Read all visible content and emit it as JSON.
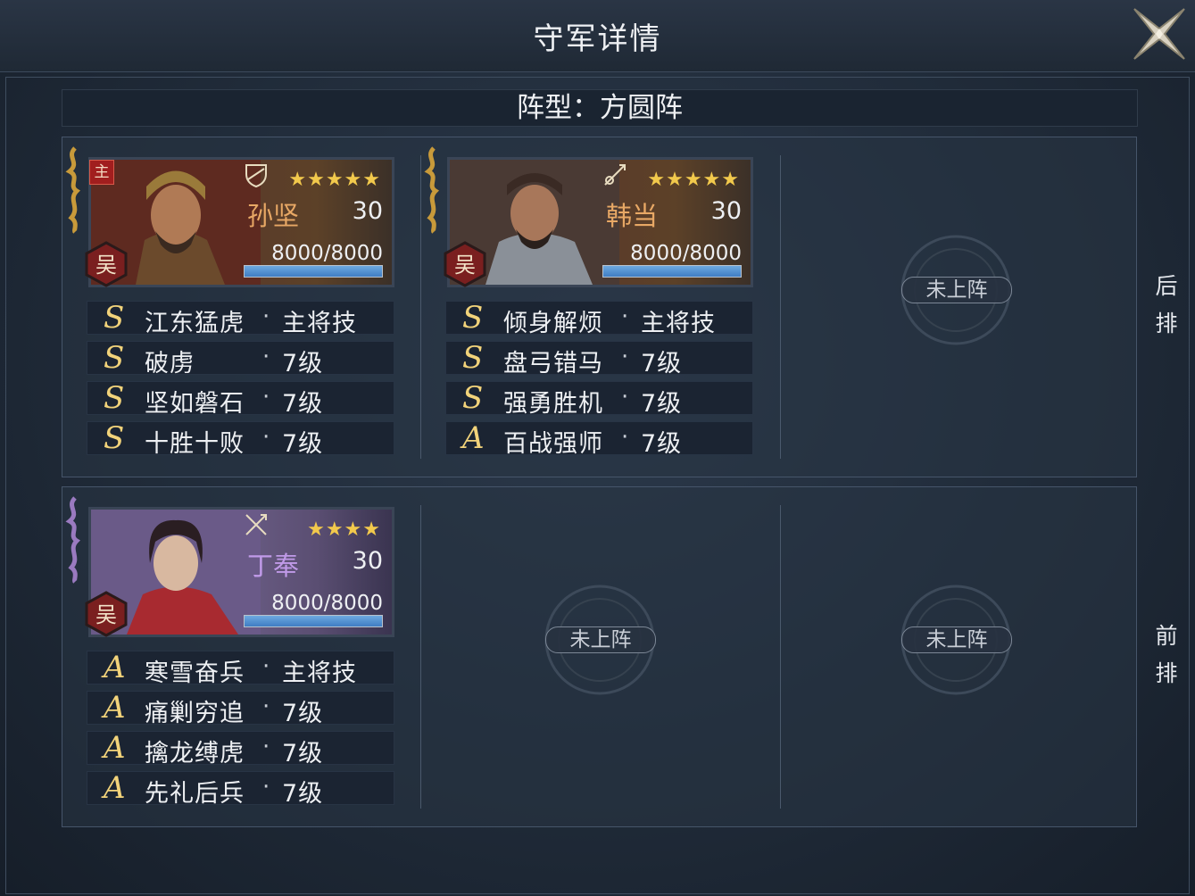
{
  "header": {
    "title": "守军详情"
  },
  "formation": {
    "label": "阵型：方圆阵"
  },
  "rows": {
    "back_label_1": "后",
    "back_label_2": "排",
    "front_label_1": "前",
    "front_label_2": "排"
  },
  "empty_slot_label": "未上阵",
  "heroes": [
    {
      "name": "孙坚",
      "level": "30",
      "troops": "8000/8000",
      "stars": "★★★★★",
      "main_badge": "主",
      "faction": "吴",
      "hp_fraction": 1.0,
      "skills": [
        {
          "grade": "S",
          "name": "江东猛虎",
          "level": "主将技"
        },
        {
          "grade": "S",
          "name": "破虏",
          "level": "7级"
        },
        {
          "grade": "S",
          "name": "坚如磐石",
          "level": "7级"
        },
        {
          "grade": "S",
          "name": "十胜十败",
          "level": "7级"
        }
      ]
    },
    {
      "name": "韩当",
      "level": "30",
      "troops": "8000/8000",
      "stars": "★★★★★",
      "faction": "吴",
      "hp_fraction": 1.0,
      "skills": [
        {
          "grade": "S",
          "name": "倾身解烦",
          "level": "主将技"
        },
        {
          "grade": "S",
          "name": "盘弓错马",
          "level": "7级"
        },
        {
          "grade": "S",
          "name": "强勇胜机",
          "level": "7级"
        },
        {
          "grade": "A",
          "name": "百战强师",
          "level": "7级"
        }
      ]
    },
    {
      "name": "丁奉",
      "level": "30",
      "troops": "8000/8000",
      "stars": "★★★★",
      "faction": "吴",
      "hp_fraction": 1.0,
      "skills": [
        {
          "grade": "A",
          "name": "寒雪奋兵",
          "level": "主将技"
        },
        {
          "grade": "A",
          "name": "痛剿穷追",
          "level": "7级"
        },
        {
          "grade": "A",
          "name": "擒龙缚虎",
          "level": "7级"
        },
        {
          "grade": "A",
          "name": "先礼后兵",
          "level": "7级"
        }
      ]
    }
  ],
  "separator": "·",
  "icons": {
    "close": "close-x-icon",
    "shield": "shield-icon",
    "spear": "spear-icon",
    "crossed_weapons": "crossed-weapons-icon"
  },
  "colors": {
    "star": "#f2c94c",
    "grade": "#f2d37a",
    "name_gold": "#e8a865",
    "name_purple": "#c09ae8",
    "hp_bar": "#4f8dd0"
  }
}
